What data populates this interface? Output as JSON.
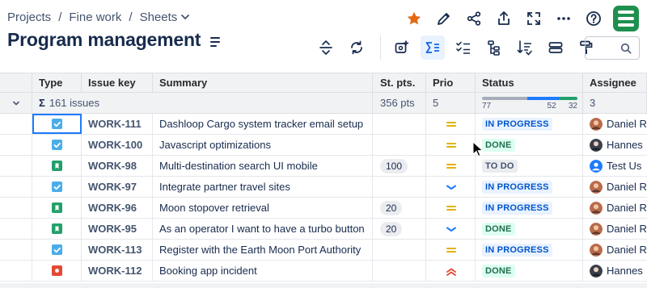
{
  "breadcrumb": {
    "items": [
      "Projects",
      "Fine work",
      "Sheets"
    ],
    "separator": "/"
  },
  "page_title": "Program management",
  "top_actions": [
    "star-icon",
    "pencil-icon",
    "share-icon",
    "export-icon",
    "fullscreen-icon",
    "more-icon",
    "help-icon",
    "app-logo"
  ],
  "toolbar": [
    "expand-collapse-icon",
    "refresh-icon",
    "custom-field-icon",
    "sum-icon",
    "checklist-icon",
    "hierarchy-icon",
    "sort-filter-icon",
    "group-icon",
    "format-painter-icon"
  ],
  "search": {
    "value": "",
    "placeholder": ""
  },
  "colors": {
    "accent": "#1d7afc",
    "brand": "#1f8f4e",
    "star": "#e56910",
    "done": "#22a06b",
    "inprogress": "#1d7afc",
    "todo": "#a5adba"
  },
  "columns": [
    "Type",
    "Issue key",
    "Summary",
    "St. pts.",
    "Prio",
    "Status",
    "Assignee"
  ],
  "group": {
    "sigma": "Σ",
    "count_label": "161 issues",
    "story_points": "356 pts",
    "prio_count": "5",
    "status_distribution": {
      "todo": 77,
      "inprogress": 52,
      "done": 32,
      "labels": [
        "77",
        "52",
        "32"
      ]
    },
    "assignee_count": "3"
  },
  "rows": [
    {
      "type": "task",
      "key": "WORK-111",
      "summary": "Dashloop Cargo system tracker email setup",
      "points": "",
      "priority": "medium",
      "status": "IN PROGRESS",
      "status_kind": "inprogress",
      "assignee": "Daniel R",
      "avatar": "daniel"
    },
    {
      "type": "task",
      "key": "WORK-100",
      "summary": "Javascript optimizations",
      "points": "",
      "priority": "medium",
      "status": "DONE",
      "status_kind": "done",
      "assignee": "Hannes",
      "avatar": "hannes"
    },
    {
      "type": "story",
      "key": "WORK-98",
      "summary": "Multi-destination search UI mobile",
      "points": "100",
      "priority": "medium",
      "status": "TO DO",
      "status_kind": "todo",
      "assignee": "Test Us",
      "avatar": "test"
    },
    {
      "type": "task",
      "key": "WORK-97",
      "summary": "Integrate partner travel sites",
      "points": "",
      "priority": "low",
      "status": "IN PROGRESS",
      "status_kind": "inprogress",
      "assignee": "Daniel R",
      "avatar": "daniel"
    },
    {
      "type": "story",
      "key": "WORK-96",
      "summary": "Moon stopover retrieval",
      "points": "20",
      "priority": "medium",
      "status": "IN PROGRESS",
      "status_kind": "inprogress",
      "assignee": "Daniel R",
      "avatar": "daniel"
    },
    {
      "type": "story",
      "key": "WORK-95",
      "summary": "As an operator I want to have a turbo button",
      "points": "20",
      "priority": "low",
      "status": "DONE",
      "status_kind": "done",
      "assignee": "Daniel R",
      "avatar": "daniel"
    },
    {
      "type": "task",
      "key": "WORK-113",
      "summary": "Register with the Earth Moon Port Authority",
      "points": "",
      "priority": "medium",
      "status": "IN PROGRESS",
      "status_kind": "inprogress",
      "assignee": "Daniel R",
      "avatar": "daniel"
    },
    {
      "type": "bug",
      "key": "WORK-112",
      "summary": "Booking app incident",
      "points": "",
      "priority": "high",
      "status": "DONE",
      "status_kind": "done",
      "assignee": "Hannes",
      "avatar": "hannes"
    }
  ]
}
